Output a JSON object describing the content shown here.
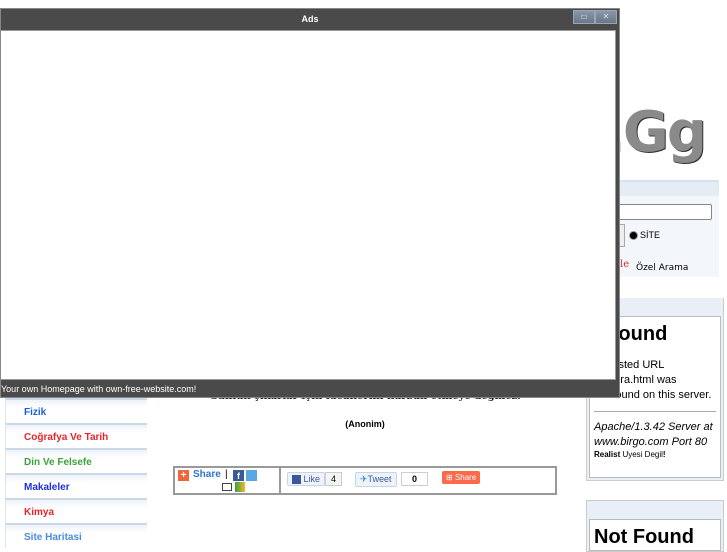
{
  "overlay": {
    "title": "Ads",
    "footer": "Your own Homepage with own-free-website.com!"
  },
  "nav": {
    "items": [
      {
        "label": "Fizik",
        "color": "#1a5fd6"
      },
      {
        "label": "Coğrafya Ve Tarih",
        "color": "#e8242b"
      },
      {
        "label": "Din Ve Felsefe",
        "color": "#3aa23a"
      },
      {
        "label": "Makaleler",
        "color": "#1a2fe0"
      },
      {
        "label": "Kimya",
        "color": "#e8242b"
      },
      {
        "label": "Site Haritasi",
        "color": "#4a8be0"
      }
    ]
  },
  "content": {
    "quote": "Günlük çıkarlar için ideallerini kurban etmeye değmez.",
    "author": "(Anonim)"
  },
  "share": {
    "share_label": "Share",
    "like_label": "Like",
    "like_count": "4",
    "tweet_label": "Tweet",
    "tweet_count": "0",
    "share2_label": "Share"
  },
  "right": {
    "logo": "r.Gg",
    "radio_label": "SİTE",
    "google_partial": "le",
    "ozel": "Özel Arama",
    "nf1": {
      "title": "t Found",
      "line1": "equested URL",
      "line2": "od/fikra.html was",
      "line3": "not found on this server.",
      "server1": "Apache/1.3.42 Server at",
      "server2": "www.birgo.com Port 80",
      "realist": "Realist",
      "uyesi": " Uyesi Degil",
      "excl": "!"
    },
    "nf2": {
      "title": "Not Found"
    }
  }
}
